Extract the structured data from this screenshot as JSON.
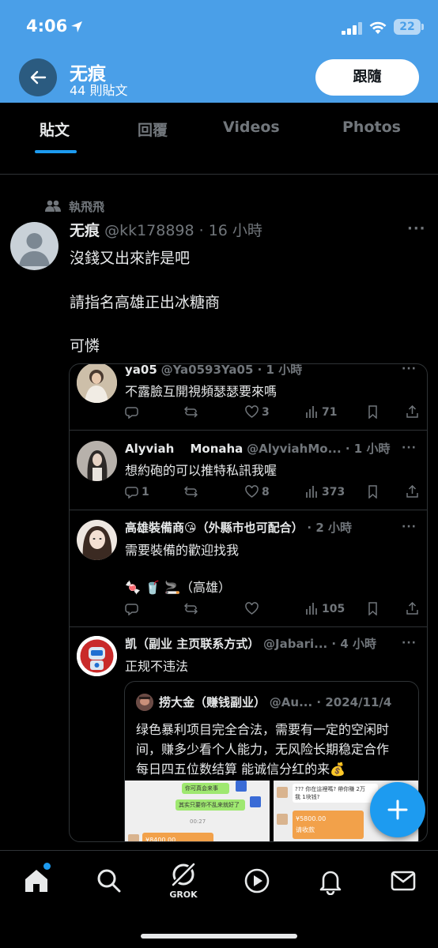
{
  "status_bar": {
    "time": "4:06",
    "battery": "22"
  },
  "header": {
    "name": "无痕",
    "post_count": "44 則貼文",
    "follow_label": "跟隨"
  },
  "tabs": [
    {
      "label": "貼文"
    },
    {
      "label": "回覆"
    },
    {
      "label": "Videos"
    },
    {
      "label": "Photos"
    }
  ],
  "post": {
    "reposted_by": "執飛飛",
    "author_name": "无痕",
    "author_meta": "@kk178898 · 16 小時",
    "lines": [
      "沒錢又出來詐是吧",
      "請指名高雄正出冰糖商",
      "可憐"
    ]
  },
  "replies": [
    {
      "name": "ya05",
      "meta": "@Ya0593Ya05 · 1 小時",
      "lines": [
        "不露臉互開視頻瑟瑟要來嗎"
      ],
      "reply_count": "",
      "like_count": "3",
      "view_count": "71"
    },
    {
      "name": "Alyviah　 Monaha",
      "meta": "@AlyviahMo... · 1 小時",
      "lines": [
        "想約砲的可以推特私訊我喔"
      ],
      "reply_count": "1",
      "like_count": "8",
      "view_count": "373"
    },
    {
      "name": "高雄裝備商😘（外縣市也可配合）",
      "meta": "· 2 小時",
      "lines": [
        "需要裝備的歡迎找我",
        "🍬 🥤 🚬（高雄）"
      ],
      "reply_count": "",
      "like_count": "",
      "view_count": "105"
    },
    {
      "name": "凯（副业 主页联系方式）",
      "meta": "@Jabari... · 4 小時",
      "lines": [
        "正规不违法"
      ]
    }
  ],
  "quote": {
    "name": "捞大金（赚钱副业）",
    "meta": "@Au... · 2024/11/4",
    "lines": [
      "绿色暴利项目完全合法，需要有一定的空闲时",
      "间，赚多少看个人能力，无风险长期稳定合作",
      "每日四五位数结算 能诚信分红的来💰"
    ],
    "img1_texts": [
      "你可真会来事",
      "其实只要你不乱来就好了",
      "00:27",
      "¥8400.00"
    ],
    "img2_texts": [
      "??? 你在這裡嗎? 帶你賺 2万",
      "我 1块钱?",
      "¥5800.00",
      "请收款"
    ]
  },
  "bottom_nav": {
    "grok_label": "GROK"
  },
  "colors": {
    "accent": "#1d9bf0",
    "header_bg": "#4a9fe8",
    "text_secondary": "#71767b"
  }
}
